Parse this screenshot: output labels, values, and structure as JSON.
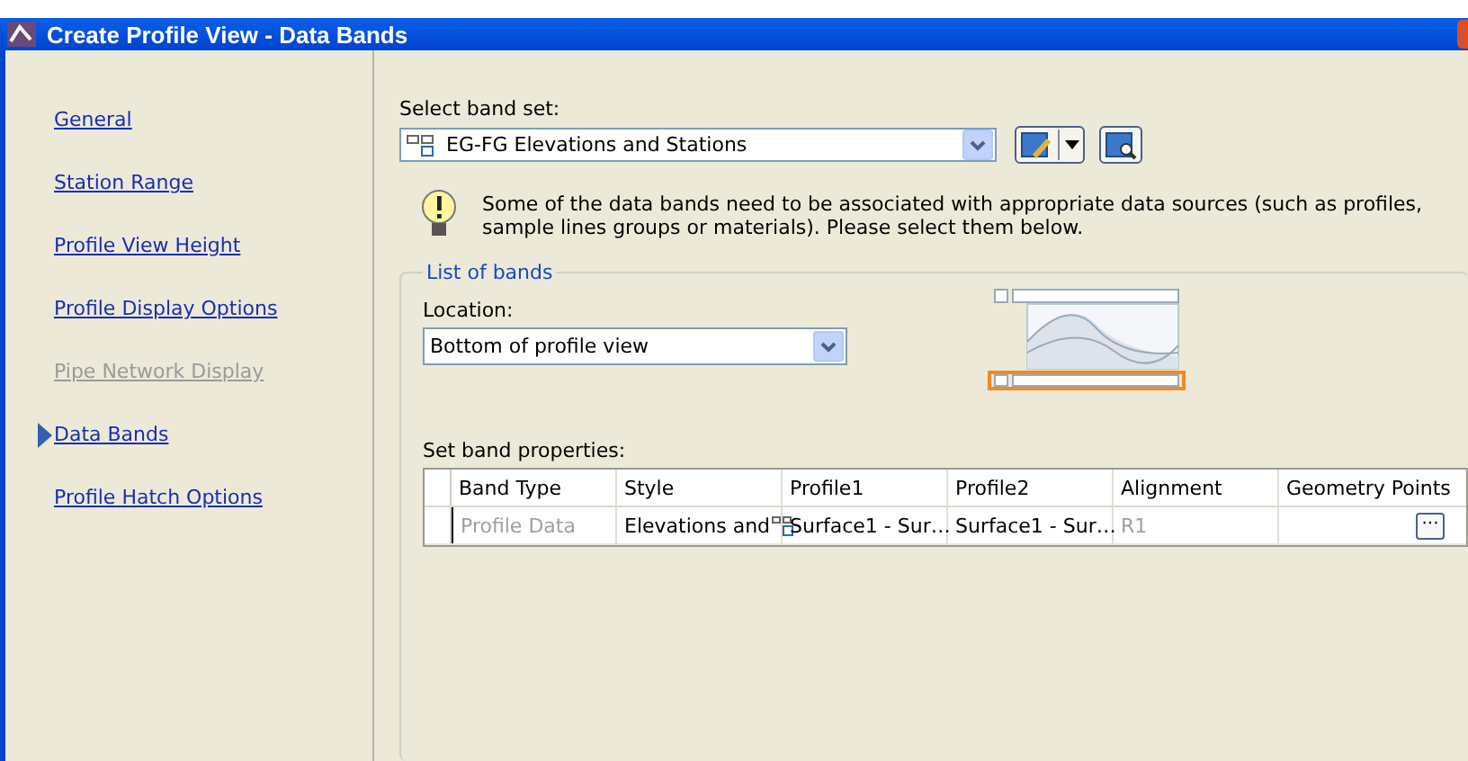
{
  "window": {
    "title": "Create Profile View - Data Bands"
  },
  "sidebar": {
    "items": [
      {
        "label": "General",
        "selected": false,
        "disabled": false
      },
      {
        "label": "Station Range",
        "selected": false,
        "disabled": false
      },
      {
        "label": "Profile View Height",
        "selected": false,
        "disabled": false
      },
      {
        "label": "Profile Display Options",
        "selected": false,
        "disabled": false
      },
      {
        "label": "Pipe Network Display",
        "selected": false,
        "disabled": true
      },
      {
        "label": "Data Bands",
        "selected": true,
        "disabled": false
      },
      {
        "label": "Profile Hatch Options",
        "selected": false,
        "disabled": false
      }
    ]
  },
  "band_set": {
    "label": "Select band set:",
    "value": "EG-FG Elevations and Stations"
  },
  "info": {
    "text": "Some of the data bands need to be associated with appropriate data sources (such as profiles, sample lines groups or materials). Please select them below."
  },
  "list_of_bands": {
    "title": "List of bands",
    "location_label": "Location:",
    "location_value": "Bottom of profile view"
  },
  "table": {
    "label": "Set band properties:",
    "columns": [
      "Band Type",
      "Style",
      "Profile1",
      "Profile2",
      "Alignment",
      "Geometry Points"
    ],
    "rows": [
      {
        "band_type": "Profile Data",
        "style": "Elevations and",
        "profile1": "Surface1 - Sur…",
        "profile2": "Surface1 - Sur…",
        "alignment": "R1",
        "geometry_points": "···"
      }
    ]
  }
}
